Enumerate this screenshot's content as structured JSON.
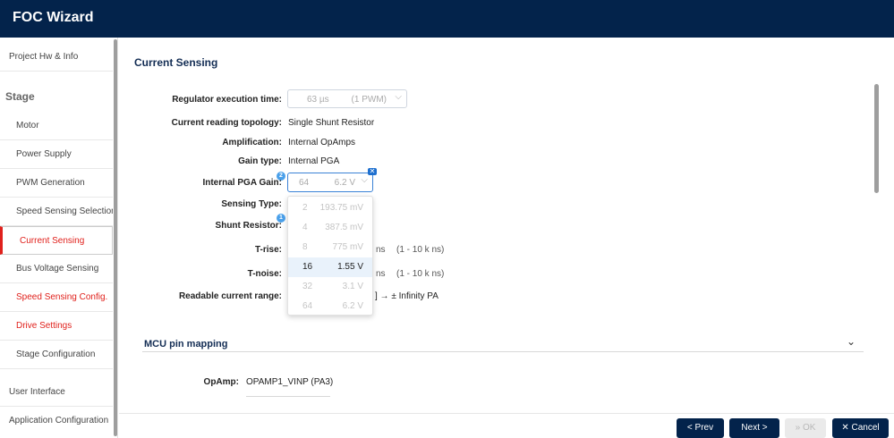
{
  "app": {
    "title": "FOC Wizard"
  },
  "colors": {
    "header_bg": "#03234b",
    "accent_red": "#e0211c",
    "focus_blue": "#3a82d6",
    "button_bg": "#03234b"
  },
  "sidebar": {
    "project": "Project Hw & Info",
    "stage_heading": "Stage",
    "items": [
      {
        "label": "Motor"
      },
      {
        "label": "Power Supply"
      },
      {
        "label": "PWM Generation"
      },
      {
        "label": "Speed Sensing Selection"
      },
      {
        "label": "Current Sensing"
      },
      {
        "label": "Bus Voltage Sensing"
      },
      {
        "label": "Speed Sensing Config."
      },
      {
        "label": "Drive Settings"
      },
      {
        "label": "Stage Configuration"
      }
    ],
    "user_interface": "User Interface",
    "app_config": "Application Configuration"
  },
  "section": {
    "title": "Current Sensing"
  },
  "form": {
    "regulator": {
      "label": "Regulator execution time:",
      "value": "63 µs",
      "suffix": "(1 PWM)"
    },
    "topology": {
      "label": "Current reading topology:",
      "value": "Single Shunt Resistor"
    },
    "amplification": {
      "label": "Amplification:",
      "value": "Internal OpAmps"
    },
    "gain_type": {
      "label": "Gain type:",
      "value": "Internal PGA"
    },
    "pga_gain": {
      "label": "Internal PGA Gain:",
      "value": "64",
      "voltage": "6.2 V",
      "badge": "2"
    },
    "sensing_type": {
      "label": "Sensing Type:"
    },
    "shunt": {
      "label": "Shunt Resistor:",
      "badge": "1"
    },
    "t_rise": {
      "label": "T-rise:",
      "unit": "ns",
      "range": "(1 - 10 k ns)"
    },
    "t_noise": {
      "label": "T-noise:",
      "unit": "ns",
      "range": "(1 - 10 k ns)"
    },
    "readable": {
      "label": "Readable current range:",
      "value": "] → ± Infinity PA"
    }
  },
  "dropdown": {
    "options": [
      {
        "gain": "2",
        "voltage": "193.75 mV",
        "state": "disabled"
      },
      {
        "gain": "4",
        "voltage": "387.5 mV",
        "state": "disabled"
      },
      {
        "gain": "8",
        "voltage": "775 mV",
        "state": "disabled"
      },
      {
        "gain": "16",
        "voltage": "1.55 V",
        "state": "selected"
      },
      {
        "gain": "32",
        "voltage": "3.1 V",
        "state": "disabled"
      },
      {
        "gain": "64",
        "voltage": "6.2 V",
        "state": "disabled"
      }
    ]
  },
  "mcu": {
    "title": "MCU pin mapping",
    "opamp_label": "OpAmp:",
    "opamp_value": "OPAMP1_VINP (PA3)"
  },
  "footer": {
    "prev": "Prev",
    "next": "Next",
    "ok": "OK",
    "cancel": "Cancel"
  }
}
